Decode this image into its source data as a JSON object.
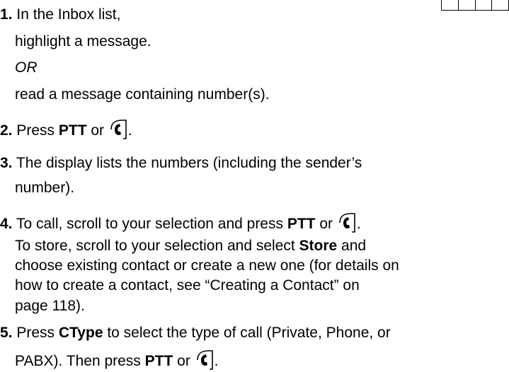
{
  "steps": [
    {
      "number": "1.",
      "lines": [
        "In the Inbox list,",
        "highlight a message."
      ],
      "or_label": "OR",
      "alt_line": "read a message containing number(s)."
    },
    {
      "number": "2.",
      "pre": "Press ",
      "key": "PTT",
      "mid": " or ",
      "post": "."
    },
    {
      "number": "3.",
      "line1": "The display lists the numbers (including the sender’s",
      "line2": "number)."
    },
    {
      "number": "4.",
      "pre": "To call, scroll to your selection and press ",
      "key": "PTT",
      "mid": " or ",
      "post": ".",
      "store_pre": "To store, scroll to your selection and select ",
      "store_key": "Store",
      "store_post": " and",
      "store_line2": "choose existing contact or create a new one (for details on",
      "store_line3": "how to create a contact, see “Creating a Contact” on",
      "store_line4": "page 118)."
    },
    {
      "number": "5.",
      "pre": "Press ",
      "key": "CType",
      "post_line1": " to select the type of call (Private, Phone, or",
      "line2_pre": "PABX). Then press ",
      "line2_key": "PTT",
      "line2_mid": " or ",
      "line2_post": "."
    }
  ],
  "icons": {
    "call": "call-key-icon"
  }
}
